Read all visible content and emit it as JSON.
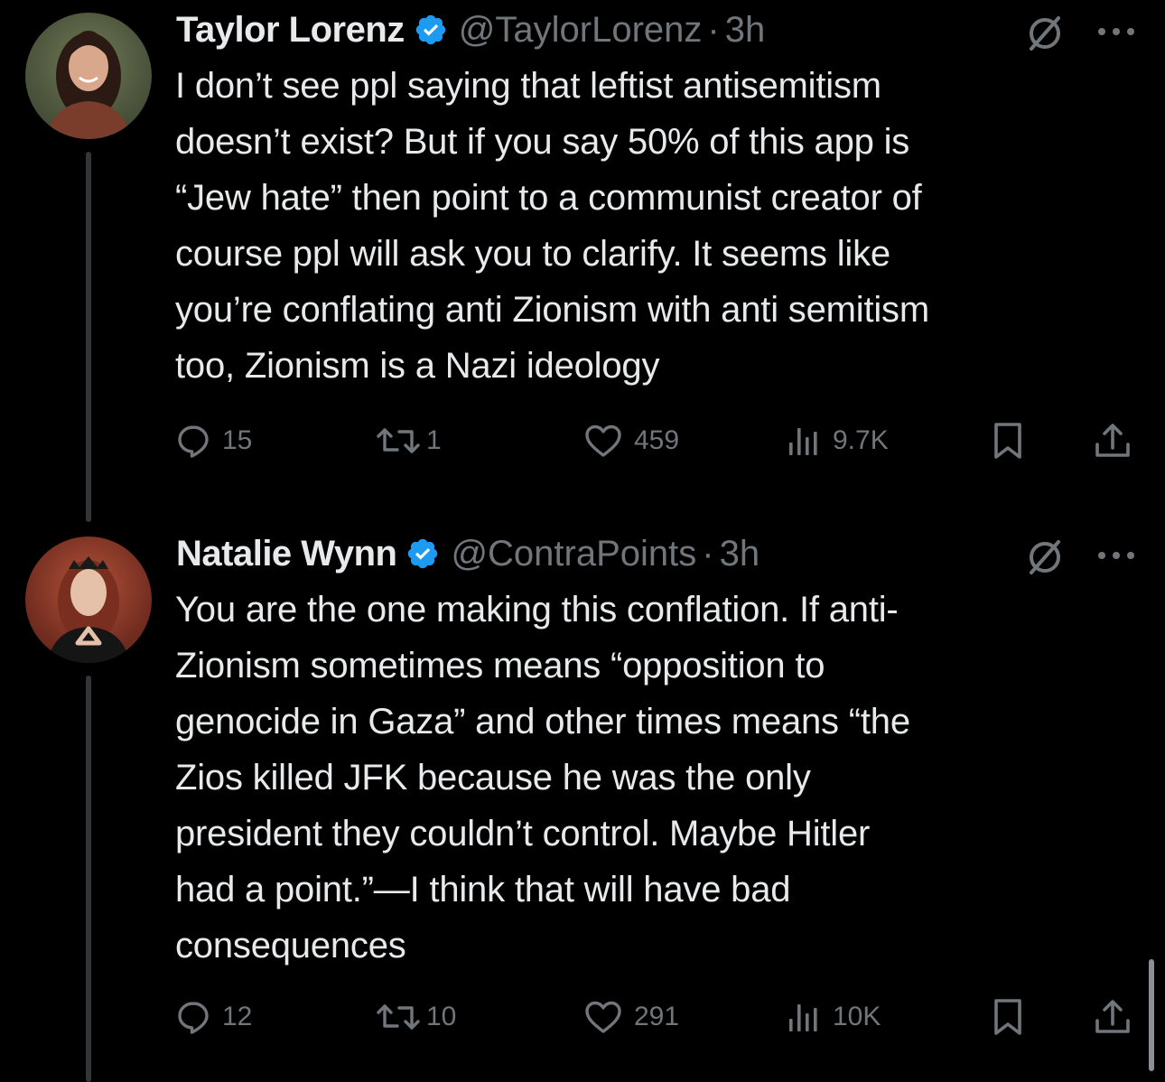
{
  "tweets": [
    {
      "name": "Taylor Lorenz",
      "handle": "@TaylorLorenz",
      "separator": "·",
      "time": "3h",
      "lines": [
        "I don’t see ppl saying that leftist antisemitism",
        "doesn’t exist? But if you say 50% of this app is",
        "“Jew hate” then point to a communist creator of",
        "course ppl will ask you to clarify. It seems like",
        "you’re conflating anti Zionism with anti semitism",
        "too, Zionism is a Nazi ideology"
      ],
      "replies": "15",
      "reposts": "1",
      "likes": "459",
      "views": "9.7K"
    },
    {
      "name": "Natalie Wynn",
      "handle": "@ContraPoints",
      "separator": "·",
      "time": "3h",
      "lines": [
        "You are the one making this conflation. If anti-",
        "Zionism sometimes means “opposition to",
        "genocide in Gaza” and other times means “the",
        "Zios killed JFK because he was the only",
        "president they couldn’t control. Maybe Hitler",
        "had a point.”—I think that will have bad",
        "consequences"
      ],
      "replies": "12",
      "reposts": "10",
      "likes": "291",
      "views": "10K"
    }
  ],
  "colors": {
    "background": "#000000",
    "text": "#e7e9ea",
    "secondary": "#71767b",
    "verified": "#1d9bf0",
    "thread_line": "#333639"
  },
  "icons": {
    "verified": "verified-badge-icon",
    "grok": "grok-icon",
    "more": "more-icon",
    "reply": "reply-icon",
    "repost": "repost-icon",
    "like": "like-icon",
    "views": "views-icon",
    "bookmark": "bookmark-icon",
    "share": "share-icon"
  }
}
